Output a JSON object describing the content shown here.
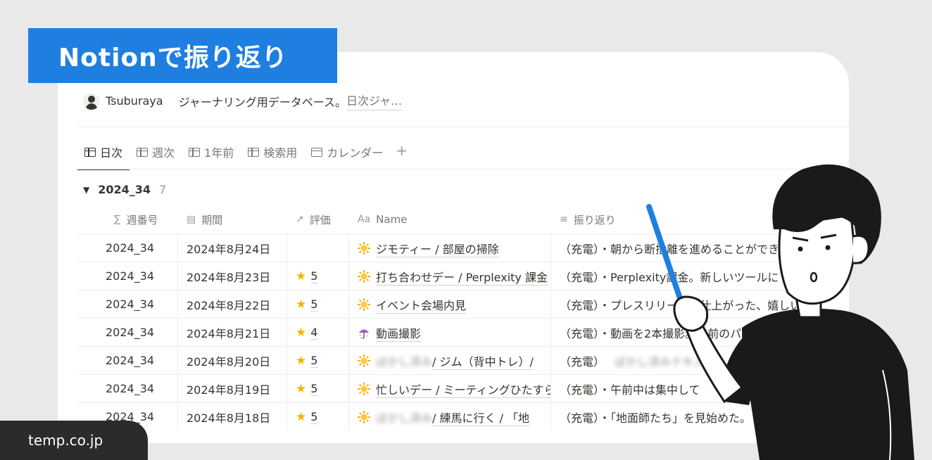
{
  "banner": {
    "title": "Notionで振り返り"
  },
  "meta": {
    "owner": "Tsuburaya",
    "description": "ジャーナリング用データベース。",
    "description_more": "日次ジャ…"
  },
  "tabs": [
    {
      "label": "日次",
      "icon": "table-icon",
      "active": true
    },
    {
      "label": "週次",
      "icon": "table-icon"
    },
    {
      "label": "1年前",
      "icon": "table-icon"
    },
    {
      "label": "検索用",
      "icon": "table-icon"
    },
    {
      "label": "カレンダー",
      "icon": "calendar-icon"
    }
  ],
  "add_view_label": "+",
  "group": {
    "label": "2024_34",
    "count": "7"
  },
  "columns": {
    "week": {
      "icon": "∑",
      "label": "週番号"
    },
    "period": {
      "icon": "▤",
      "label": "期間"
    },
    "rating": {
      "icon": "↗",
      "label": "評価"
    },
    "name": {
      "icon": "Aa",
      "label": "Name"
    },
    "reflection": {
      "icon": "≡",
      "label": "振り返り"
    }
  },
  "rows": [
    {
      "week": "2024_34",
      "period": "2024年8月24日",
      "rating": "",
      "emoji": "sun",
      "name": "ジモティー / 部屋の掃除",
      "reflection": "（充電）・朝から断捨離を進めることができ"
    },
    {
      "week": "2024_34",
      "period": "2024年8月23日",
      "rating": "5",
      "emoji": "sun",
      "name": "打ち合わせデー / Perplexity 課金",
      "reflection": "（充電）・Perplexity課金。新しいツールに"
    },
    {
      "week": "2024_34",
      "period": "2024年8月22日",
      "rating": "5",
      "emoji": "sun",
      "name": "イベント会場内見",
      "reflection": "（充電）・プレスリリースが仕上がった、嬉しい"
    },
    {
      "week": "2024_34",
      "period": "2024年8月21日",
      "rating": "4",
      "emoji": "umbrella",
      "name": "動画撮影",
      "reflection": "（充電）・動画を2本撮影。午前のパ"
    },
    {
      "week": "2024_34",
      "period": "2024年8月20日",
      "rating": "5",
      "emoji": "sun",
      "name_blur": "ぼかし済み",
      "name": " / ジム（背中トレ）/",
      "reflection": "（充電）",
      "reflection_blur": "ぼかし済みテキスト"
    },
    {
      "week": "2024_34",
      "period": "2024年8月19日",
      "rating": "5",
      "emoji": "sun",
      "name": "忙しいデー / ミーティングひたすら",
      "reflection": "（充電）・午前中は集中して"
    },
    {
      "week": "2024_34",
      "period": "2024年8月18日",
      "rating": "5",
      "emoji": "sun",
      "name_blur": "ぼかし済み",
      "name": " / 練馬に行く / 「地",
      "reflection": "（充電）・「地面師たち」を見始めた。"
    }
  ],
  "footer": {
    "domain": "temp.co.jp"
  }
}
